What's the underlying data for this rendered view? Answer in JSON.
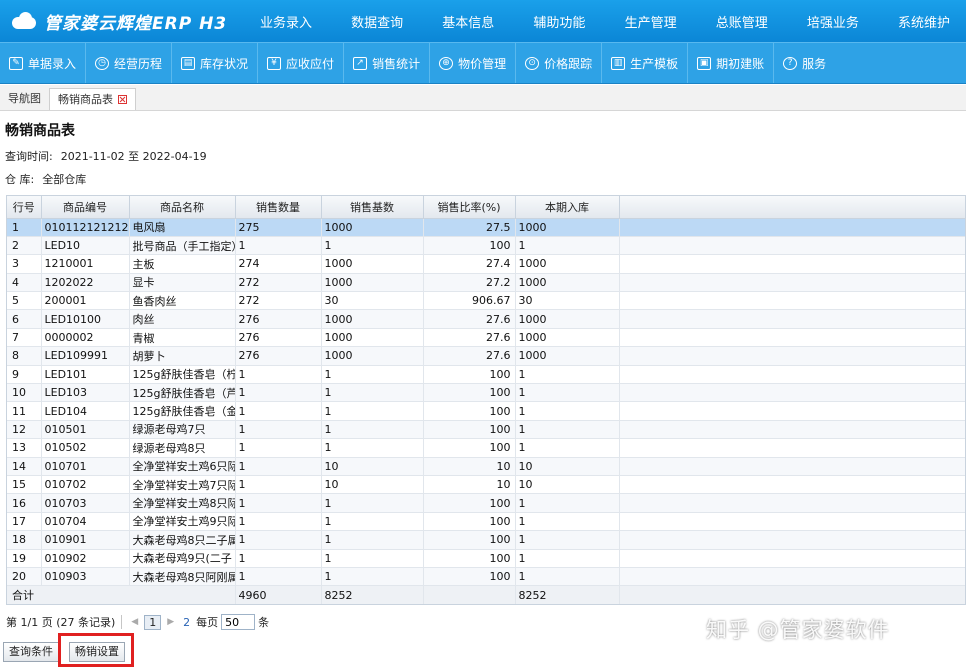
{
  "app": {
    "logo_text": "管家婆云辉煌ERP H3"
  },
  "topnav": [
    "业务录入",
    "数据查询",
    "基本信息",
    "辅助功能",
    "生产管理",
    "总账管理",
    "培强业务",
    "系统维护"
  ],
  "toolbar": [
    {
      "label": "单据录入",
      "icon": "edit-icon"
    },
    {
      "label": "经营历程",
      "icon": "clock-icon"
    },
    {
      "label": "库存状况",
      "icon": "inventory-icon"
    },
    {
      "label": "应收应付",
      "icon": "ledger-icon"
    },
    {
      "label": "销售统计",
      "icon": "chart-icon"
    },
    {
      "label": "物价管理",
      "icon": "price-icon"
    },
    {
      "label": "价格跟踪",
      "icon": "tracking-icon"
    },
    {
      "label": "生产模板",
      "icon": "template-icon"
    },
    {
      "label": "期初建账",
      "icon": "book-icon"
    },
    {
      "label": "服务",
      "icon": "help-icon"
    }
  ],
  "tabs": {
    "nav": "导航图",
    "active": "畅销商品表"
  },
  "report": {
    "title": "畅销商品表",
    "query_time_label": "查询时间:",
    "query_time_value": "2021-11-02 至 2022-04-19",
    "warehouse_label": "仓 库:",
    "warehouse_value": "全部仓库"
  },
  "grid": {
    "columns": [
      "行号",
      "商品编号",
      "商品名称",
      "销售数量",
      "销售基数",
      "销售比率(%)",
      "本期入库"
    ],
    "rows": [
      [
        "1",
        "010112121212",
        "电风扇",
        "275",
        "1000",
        "27.5",
        "1000"
      ],
      [
        "2",
        "LED10",
        "批号商品（手工指定）",
        "1",
        "1",
        "100",
        "1"
      ],
      [
        "3",
        "1210001",
        "主板",
        "274",
        "1000",
        "27.4",
        "1000"
      ],
      [
        "4",
        "1202022",
        "显卡",
        "272",
        "1000",
        "27.2",
        "1000"
      ],
      [
        "5",
        "200001",
        "鱼香肉丝",
        "272",
        "30",
        "906.67",
        "30"
      ],
      [
        "6",
        "LED10100",
        "肉丝",
        "276",
        "1000",
        "27.6",
        "1000"
      ],
      [
        "7",
        "0000002",
        "青椒",
        "276",
        "1000",
        "27.6",
        "1000"
      ],
      [
        "8",
        "LED109991",
        "胡萝卜",
        "276",
        "1000",
        "27.6",
        "1000"
      ],
      [
        "9",
        "LED101",
        "125g舒肤佳香皂（柠",
        "1",
        "1",
        "100",
        "1"
      ],
      [
        "10",
        "LED103",
        "125g舒肤佳香皂（芦",
        "1",
        "1",
        "100",
        "1"
      ],
      [
        "11",
        "LED104",
        "125g舒肤佳香皂（金",
        "1",
        "1",
        "100",
        "1"
      ],
      [
        "12",
        "010501",
        "绿源老母鸡7只",
        "1",
        "1",
        "100",
        "1"
      ],
      [
        "13",
        "010502",
        "绿源老母鸡8只",
        "1",
        "1",
        "100",
        "1"
      ],
      [
        "14",
        "010701",
        "全净堂祥安土鸡6只际",
        "1",
        "10",
        "10",
        "10"
      ],
      [
        "15",
        "010702",
        "全净堂祥安土鸡7只际",
        "1",
        "10",
        "10",
        "10"
      ],
      [
        "16",
        "010703",
        "全净堂祥安土鸡8只际",
        "1",
        "1",
        "100",
        "1"
      ],
      [
        "17",
        "010704",
        "全净堂祥安土鸡9只际",
        "1",
        "1",
        "100",
        "1"
      ],
      [
        "18",
        "010901",
        "大森老母鸡8只二子属",
        "1",
        "1",
        "100",
        "1"
      ],
      [
        "19",
        "010902",
        "大森老母鸡9只(二子",
        "1",
        "1",
        "100",
        "1"
      ],
      [
        "20",
        "010903",
        "大森老母鸡8只阿刚属",
        "1",
        "1",
        "100",
        "1"
      ]
    ],
    "total": {
      "label": "合计",
      "qty": "4960",
      "base": "8252",
      "stock": "8252"
    }
  },
  "pager": {
    "summary": "第 1/1 页 (27 条记录)",
    "current_page": "1",
    "next_page": "2",
    "per_page_label": "每页",
    "per_page_value": "50",
    "unit": "条"
  },
  "buttons": {
    "query_conditions": "查询条件",
    "bestseller_settings": "畅销设置"
  },
  "watermark": "知乎 @管家婆软件",
  "colors": {
    "topbar": "#0b86d6",
    "toolbar": "#2ea2e6",
    "selected_row": "#bcd9f5",
    "highlight_box": "#e02020"
  }
}
